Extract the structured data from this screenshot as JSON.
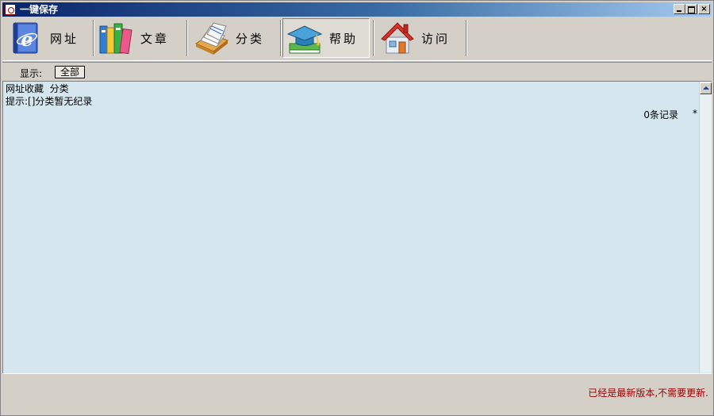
{
  "window": {
    "title": "一键保存",
    "controls": {
      "minimize": "",
      "maximize": "",
      "close": "×"
    }
  },
  "toolbar": {
    "buttons": [
      {
        "label": "网址",
        "icon": "ie-book-icon",
        "pressed": false
      },
      {
        "label": "文章",
        "icon": "books-icon",
        "pressed": false
      },
      {
        "label": "分类",
        "icon": "card-file-icon",
        "pressed": false
      },
      {
        "label": "帮助",
        "icon": "graduation-cap-icon",
        "pressed": true
      },
      {
        "label": "访问",
        "icon": "house-icon",
        "pressed": false
      }
    ]
  },
  "filter": {
    "label": "显示:",
    "button": "全部"
  },
  "content": {
    "breadcrumb": "网址收藏  分类",
    "hint": "提示:[]分类暂无纪录",
    "count": "0条记录",
    "asterisk": "*"
  },
  "status": {
    "message": "已经是最新版本,不需要更新.",
    "color": "#9b0000"
  }
}
